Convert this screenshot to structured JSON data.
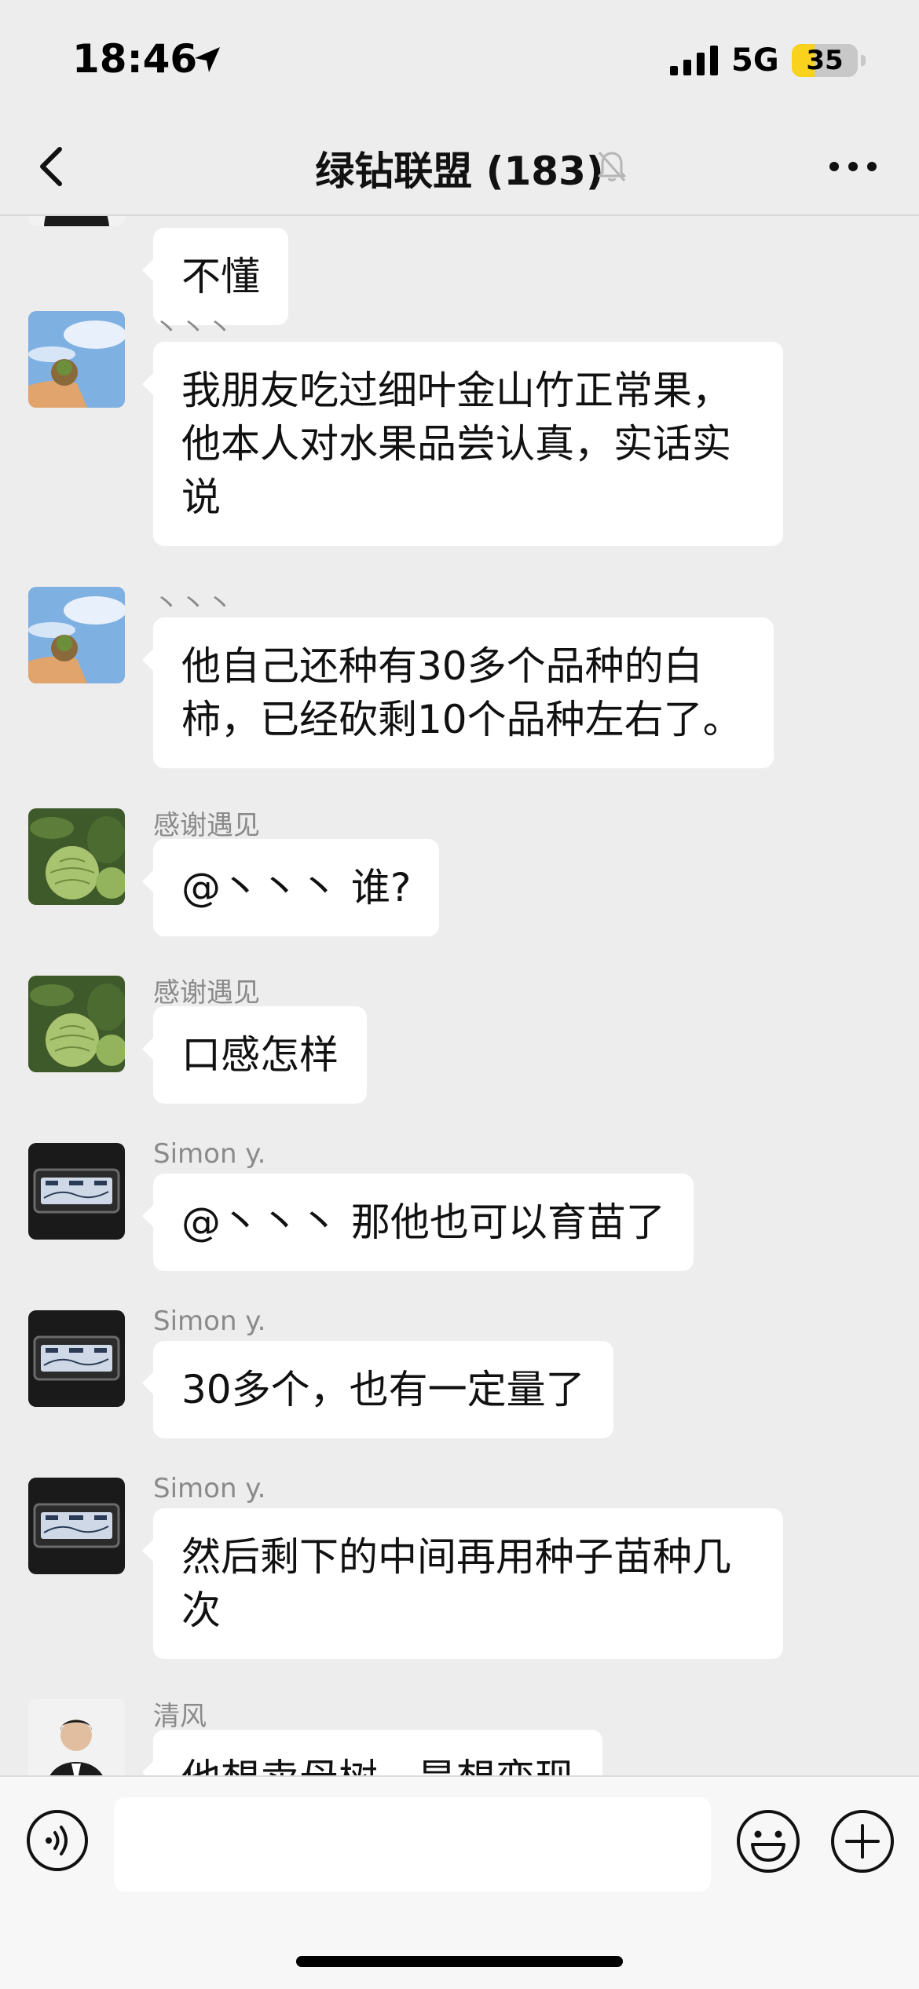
{
  "status_bar": {
    "time": "18:46",
    "network": "5G",
    "battery_level": "35",
    "battery_fraction": 0.35,
    "icons": [
      "location-arrow-icon",
      "cellular-signal-icon",
      "battery-icon"
    ]
  },
  "nav": {
    "title": "绿钻联盟 (183)",
    "icons": [
      "back-chevron-icon",
      "mute-bell-icon",
      "more-dots-icon"
    ]
  },
  "messages": [
    {
      "sender": "",
      "text": "不懂",
      "avatar": "person-suit-avatar"
    },
    {
      "sender": "丶丶丶",
      "text": "我朋友吃过细叶金山竹正常果，他本人对水果品尝认真，实话实说",
      "avatar": "sky-fruit-avatar"
    },
    {
      "sender": "丶丶丶",
      "text": "他自己还种有30多个品种的白柿，已经砍剩10个品种左右了。",
      "avatar": "sky-fruit-avatar"
    },
    {
      "sender": "感谢遇见",
      "text": "@丶丶丶 谁?",
      "avatar": "green-fruit-avatar"
    },
    {
      "sender": "感谢遇见",
      "text": "口感怎样",
      "avatar": "green-fruit-avatar"
    },
    {
      "sender": "Simon y.",
      "text": "@丶丶丶 那他也可以育苗了",
      "avatar": "car-dashboard-avatar"
    },
    {
      "sender": "Simon y.",
      "text": "30多个，也有一定量了",
      "avatar": "car-dashboard-avatar"
    },
    {
      "sender": "Simon y.",
      "text": "然后剩下的中间再用种子苗种几次",
      "avatar": "car-dashboard-avatar"
    },
    {
      "sender": "清风",
      "text": "他想卖母树，是想变现",
      "avatar": "person-suit-avatar"
    }
  ],
  "input": {
    "value": "",
    "icons": [
      "voice-icon",
      "emoji-icon",
      "plus-icon"
    ]
  },
  "colors": {
    "background": "#ededed",
    "bubble": "#ffffff",
    "battery": "#f8d21c",
    "sender_name": "#8a8a8a"
  }
}
